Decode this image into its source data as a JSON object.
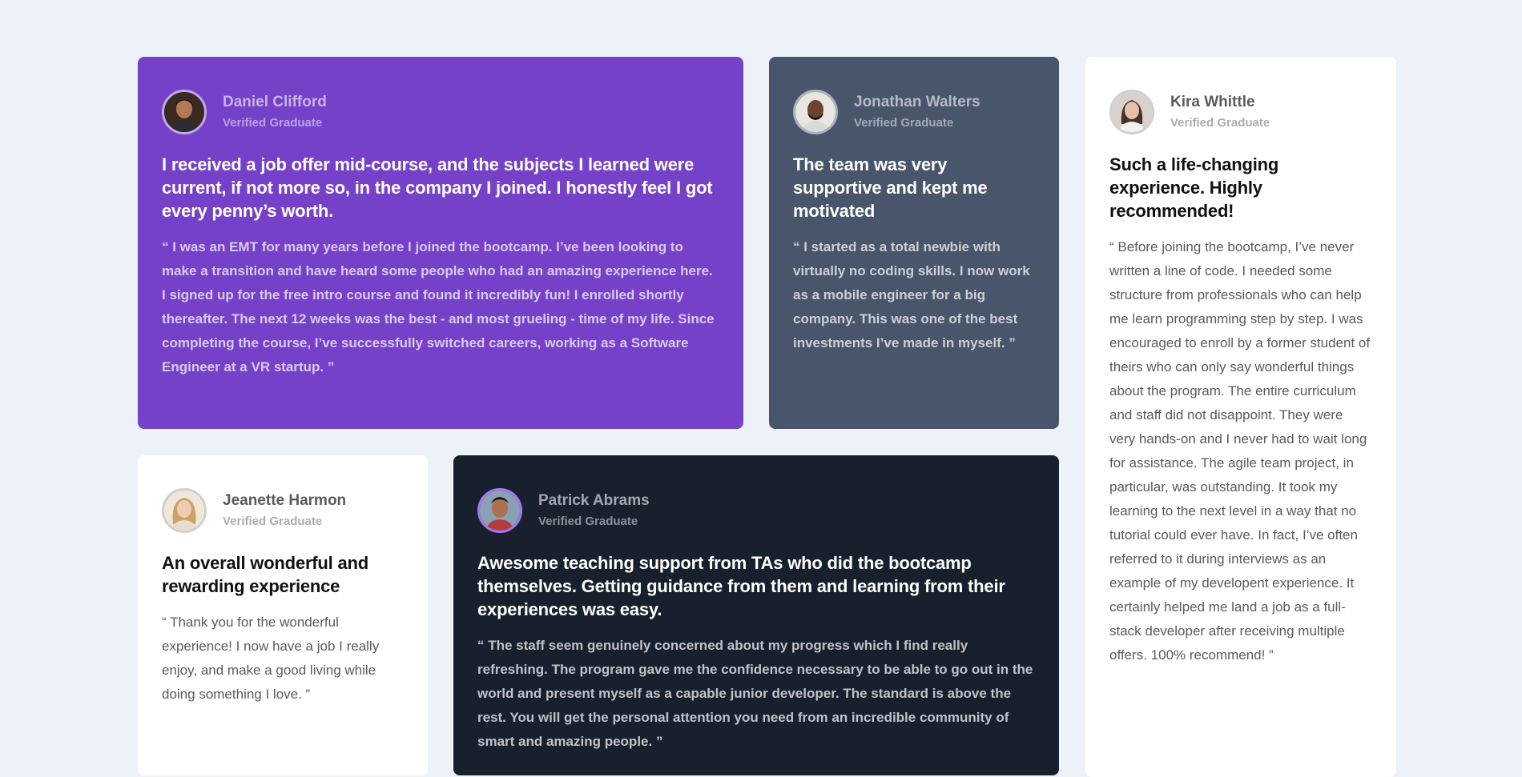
{
  "testimonials": [
    {
      "name": "Daniel Clifford",
      "role": "Verified Graduate",
      "title": "I received a job offer mid-course, and the subjects I learned were current, if not more so, in the company I joined. I honestly feel I got every penny’s worth.",
      "quote": "“ I was an EMT for many years before I joined the bootcamp. I’ve been looking to make a transition and have heard some people who had an amazing experience here. I signed up for the free intro course and found it incredibly fun! I enrolled shortly thereafter. The next 12 weeks was the best - and most grueling - time of my life. Since completing the course, I’ve successfully switched careers, working as a Software Engineer at a VR startup. ”",
      "color": "#7541c8"
    },
    {
      "name": "Jonathan Walters",
      "role": "Verified Graduate",
      "title": "The team was very supportive and kept me motivated",
      "quote": "“ I started as a total newbie with virtually no coding skills. I now work as a mobile engineer for a big company. This was one of the best investments I’ve made in myself. ”",
      "color": "#48556a"
    },
    {
      "name": "Kira Whittle",
      "role": "Verified Graduate",
      "title": "Such a life-changing experience. Highly recommended!",
      "quote": "“ Before joining the bootcamp, I’ve never written a line of code. I needed some structure from professionals who can help me learn programming step by step. I was encouraged to enroll by a former student of theirs who can only say wonderful things about the program. The entire curriculum and staff did not disappoint. They were very hands-on and I never had to wait long for assistance. The agile team project, in particular, was outstanding. It took my learning to the next level in a way that no tutorial could ever have. In fact, I’ve often referred to it during interviews as an example of my developent experience. It certainly helped me land a job as a full-stack developer after receiving multiple offers. 100% recommend! ”",
      "color": "#ffffff"
    },
    {
      "name": "Jeanette Harmon",
      "role": "Verified Graduate",
      "title": "An overall wonderful and rewarding experience",
      "quote": "“ Thank you for the wonderful experience! I now have a job I really enjoy, and make a good living while doing something I love. ”",
      "color": "#ffffff"
    },
    {
      "name": "Patrick Abrams",
      "role": "Verified Graduate",
      "title": "Awesome teaching support from TAs who did the bootcamp themselves. Getting guidance from them and learning from their experiences was easy.",
      "quote": "“ The staff seem genuinely concerned about my progress which I find really refreshing. The program gave me the confidence necessary to be able to go out in the world and present myself as a capable junior developer. The standard is above the rest. You will get the personal attention you need from an incredible community of smart and amazing people. ”",
      "color": "#19202d"
    }
  ],
  "page": {
    "background": "#edf2f8",
    "avatar_icon": "person-avatar-icon"
  }
}
